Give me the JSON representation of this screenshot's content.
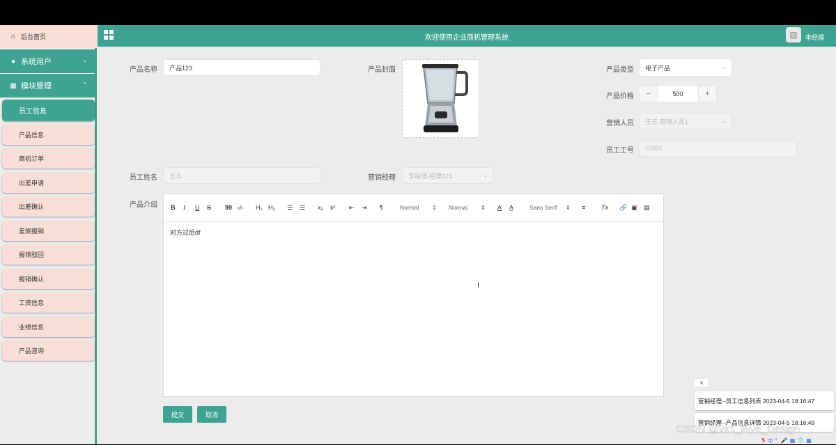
{
  "header": {
    "title": "欢迎使用企业商机管理系统",
    "user": "李经理"
  },
  "sidebar": {
    "home": "后台首页",
    "sections": [
      {
        "label": "系统用户",
        "chevron": "chevron-down"
      },
      {
        "label": "模块管理",
        "chevron": "chevron-up"
      }
    ],
    "items": [
      {
        "label": "员工信息",
        "active": true
      },
      {
        "label": "产品信息"
      },
      {
        "label": "商机订单"
      },
      {
        "label": "出差申请"
      },
      {
        "label": "出差确认"
      },
      {
        "label": "差旅报销"
      },
      {
        "label": "报销驳回"
      },
      {
        "label": "报销确认"
      },
      {
        "label": "工资信息"
      },
      {
        "label": "业绩信息"
      },
      {
        "label": "产品咨询"
      }
    ]
  },
  "form": {
    "product_name": {
      "label": "产品名称",
      "value": "产品123"
    },
    "product_cover": {
      "label": "产品封面"
    },
    "product_type": {
      "label": "产品类型",
      "value": "电子产品"
    },
    "product_price": {
      "label": "产品价格",
      "value": "500",
      "minus": "−",
      "plus": "+"
    },
    "sales_person": {
      "label": "营销人员",
      "value": "王五-营销人员1"
    },
    "employee_no": {
      "label": "员工工号",
      "value": "10001"
    },
    "employee_name": {
      "label": "员工姓名",
      "value": "王五"
    },
    "sales_manager": {
      "label": "营销经理",
      "value": "李经理-经理123"
    },
    "product_intro": {
      "label": "产品介绍",
      "content": "对方过后df"
    }
  },
  "editor": {
    "toolbar": {
      "bold": "B",
      "italic": "I",
      "underline": "U",
      "strike": "S",
      "quote": "99",
      "code": "‹/›",
      "h1": "H₁",
      "h2": "H₂",
      "ordered_list": "☰",
      "bullet_list": "☰",
      "subscript": "x₂",
      "superscript": "x²",
      "outdent": "⇤",
      "indent": "⇥",
      "direction": "¶",
      "size": "Normal",
      "header": "Normal",
      "color": "A",
      "background": "A̲",
      "font": "Sans Serif",
      "align": "≡",
      "clean": "Tx",
      "link": "🔗",
      "image": "▣",
      "video": "▤",
      "picker_arrow": "⇕"
    }
  },
  "buttons": {
    "submit": "提交",
    "cancel": "取消"
  },
  "notifications": {
    "close": "x",
    "items": [
      {
        "text": "营销经理--员工信息列表 2023-04-5 18:16:47"
      },
      {
        "text": "营销经理--产品信息详情 2023-04-5 18:16:49"
      }
    ]
  },
  "watermark": "CSDN @vx1_Biye_Design",
  "ime": {
    "logo": "S",
    "items": [
      "中",
      "°,",
      "🎤",
      "▦",
      "👕",
      "▦"
    ]
  },
  "colors": {
    "accent": "#3fa391",
    "sidebar_item_bg": "#f8ded7",
    "page_bg": "#ececec"
  }
}
